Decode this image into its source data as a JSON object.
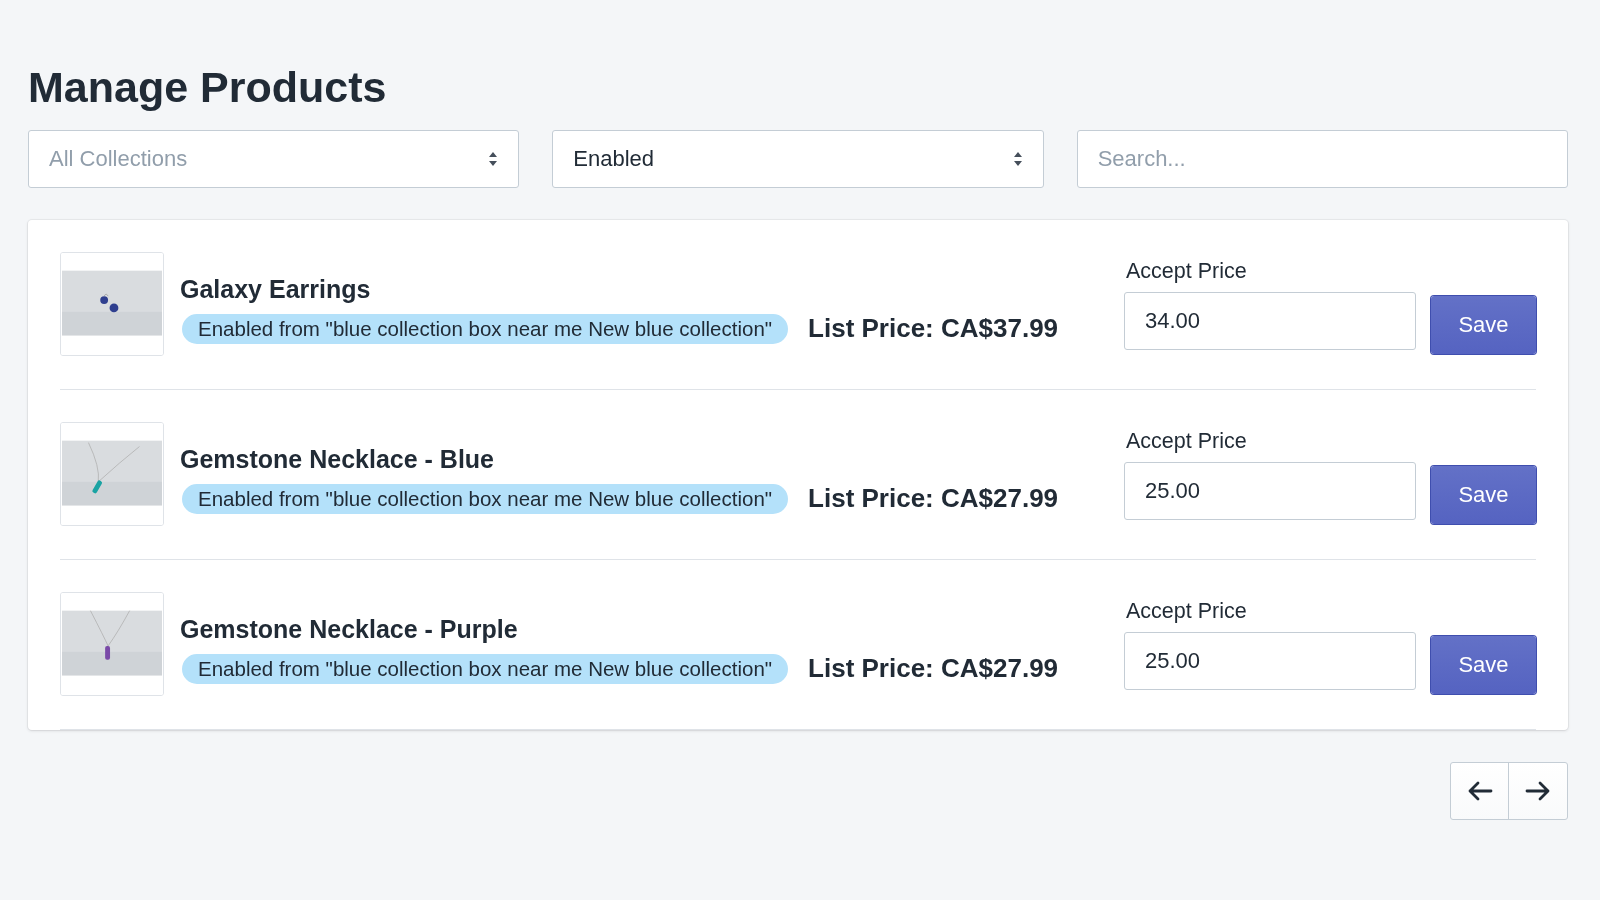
{
  "title": "Manage Products",
  "filters": [
    {
      "kind": "select",
      "text": "All Collections",
      "muted": true
    },
    {
      "kind": "select",
      "text": "Enabled",
      "muted": false
    },
    {
      "kind": "search",
      "placeholder": "Search..."
    }
  ],
  "products": [
    {
      "name": "Galaxy Earrings",
      "badge": "Enabled from \"blue collection box near me New blue collection\"",
      "list_price": "List Price: CA$37.99",
      "accept_label": "Accept Price",
      "accept_value": "34.00",
      "button": "Save"
    },
    {
      "name": "Gemstone Necklace - Blue",
      "badge": "Enabled from \"blue collection box near me New blue collection\"",
      "list_price": "List Price: CA$27.99",
      "accept_label": "Accept Price",
      "accept_value": "25.00",
      "button": "Save"
    },
    {
      "name": "Gemstone Necklace - Purple",
      "badge": "Enabled from \"blue collection box near me New blue collection\"",
      "list_price": "List Price: CA$27.99",
      "accept_label": "Accept Price",
      "accept_value": "25.00",
      "button": "Save"
    }
  ]
}
